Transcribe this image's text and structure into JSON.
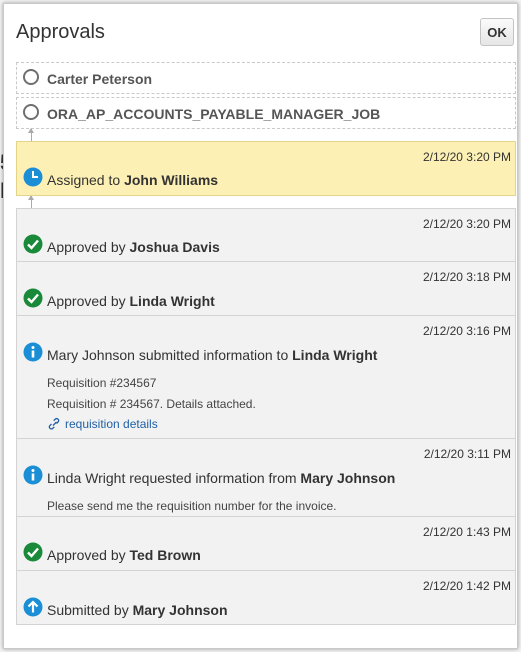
{
  "dialog": {
    "title": "Approvals",
    "ok_label": "OK"
  },
  "future_approvers": [
    {
      "name": "Carter Peterson"
    },
    {
      "name": "ORA_AP_ACCOUNTS_PAYABLE_MANAGER_JOB"
    }
  ],
  "history": [
    {
      "timestamp": "2/12/20 3:20 PM",
      "prefix": "Assigned to ",
      "actor": "John Williams",
      "icon": "clock-icon",
      "status": "current"
    },
    {
      "timestamp": "2/12/20 3:20 PM",
      "prefix": "Approved by ",
      "actor": "Joshua Davis",
      "icon": "check-icon"
    },
    {
      "timestamp": "2/12/20 3:18 PM",
      "prefix": "Approved by ",
      "actor": "Linda Wright",
      "icon": "check-icon"
    },
    {
      "timestamp": "2/12/20 3:16 PM",
      "prefix": "Mary Johnson submitted information to ",
      "actor": "Linda Wright",
      "icon": "info-icon",
      "details": [
        "Requisition #234567",
        "Requisition # 234567. Details attached."
      ],
      "link_label": "requisition details"
    },
    {
      "timestamp": "2/12/20 3:11 PM",
      "prefix": "Linda Wright requested information from ",
      "actor": "Mary Johnson",
      "icon": "info-icon",
      "details": [
        "Please send me the requisition number for the invoice."
      ]
    },
    {
      "timestamp": "2/12/20 1:43 PM",
      "prefix": "Approved by ",
      "actor": "Ted Brown",
      "icon": "check-icon"
    },
    {
      "timestamp": "2/12/20 1:42 PM",
      "prefix": "Submitted by ",
      "actor": "Mary Johnson",
      "icon": "arrow-up-icon"
    }
  ],
  "colors": {
    "current_highlight": "#fcf0b4",
    "approved_green": "#1a8a3a",
    "info_blue": "#1b8fd6",
    "link_blue": "#1f5fa6"
  }
}
